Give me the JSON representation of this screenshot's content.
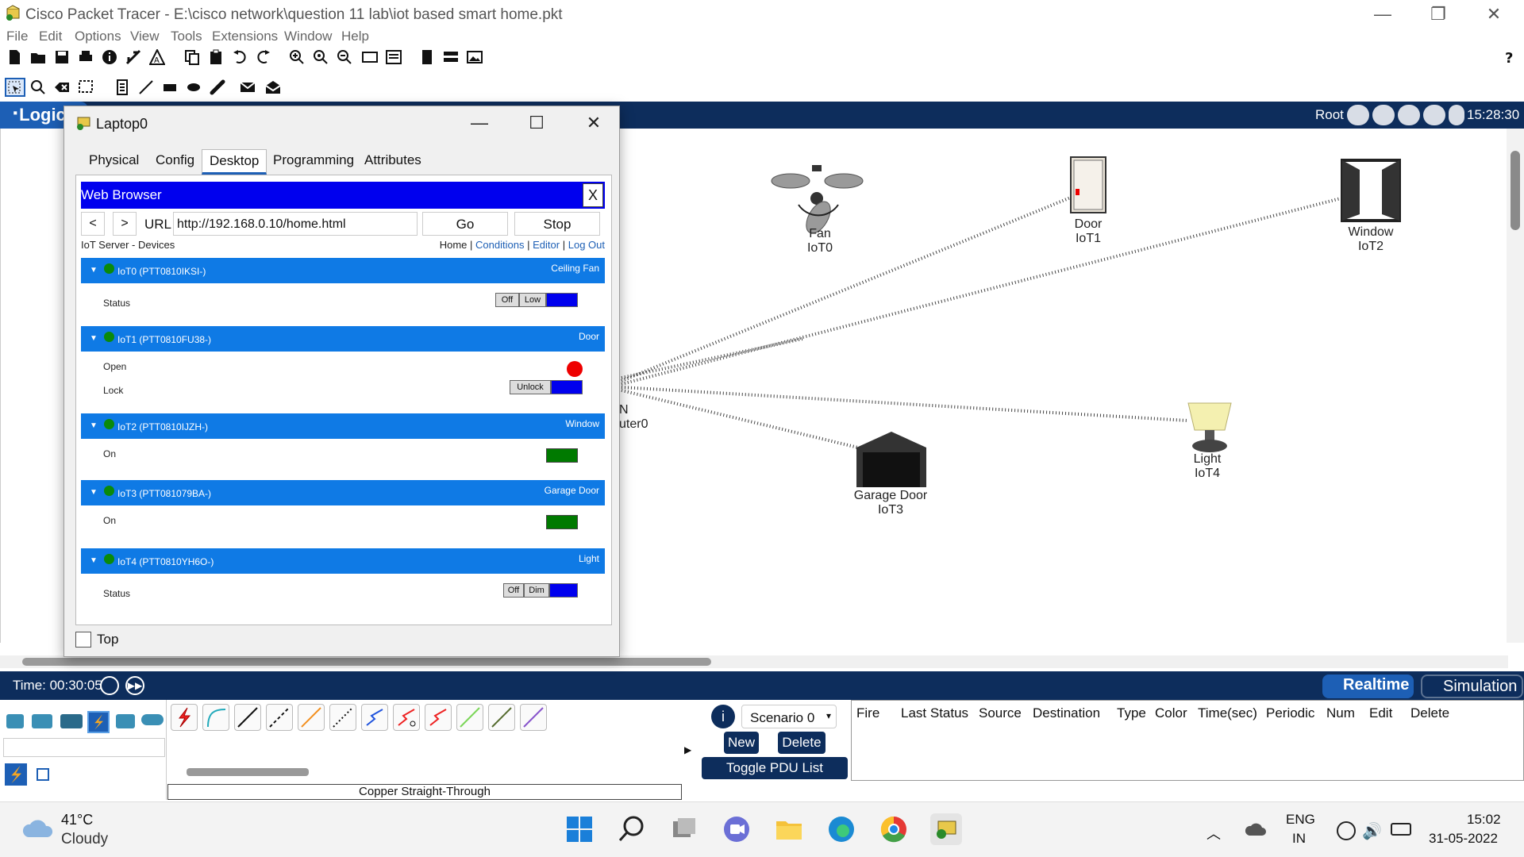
{
  "window": {
    "title": "Cisco Packet Tracer - E:\\cisco network\\question 11 lab\\iot based smart home.pkt",
    "minimize": "—",
    "restore": "❐",
    "close": "✕"
  },
  "menu": [
    "File",
    "Edit",
    "Options",
    "View",
    "Tools",
    "Extensions",
    "Window",
    "Help"
  ],
  "help_icon": "?",
  "workspace": {
    "mode_label": "Logical",
    "root_label": "Root",
    "clock": "15:28:30"
  },
  "devices": [
    {
      "name": "Fan",
      "id": "IoT0"
    },
    {
      "name": "Door",
      "id": "IoT1"
    },
    {
      "name": "Window",
      "id": "IoT2"
    },
    {
      "name": "Garage Door",
      "id": "IoT3"
    },
    {
      "name": "Light",
      "id": "IoT4"
    }
  ],
  "router_partial": [
    "N",
    "uter0"
  ],
  "timebar": {
    "time": "Time: 00:30:05",
    "realtime": "Realtime",
    "simulation": "Simulation"
  },
  "bottom": {
    "cable_caption": "Copper Straight-Through",
    "scenario": "Scenario 0",
    "new": "New",
    "delete": "Delete",
    "toggle": "Toggle PDU List Window",
    "pdu_headers": [
      "Fire",
      "Last Status",
      "Source",
      "Destination",
      "Type",
      "Color",
      "Time(sec)",
      "Periodic",
      "Num",
      "Edit",
      "Delete"
    ]
  },
  "dialog": {
    "title": "Laptop0",
    "minimize": "—",
    "maximize": "☐",
    "close": "✕",
    "tabs": [
      "Physical",
      "Config",
      "Desktop",
      "Programming",
      "Attributes"
    ],
    "active_tab": "Desktop",
    "top_label": "Top",
    "browser": {
      "title": "Web Browser",
      "close": "X",
      "back": "<",
      "forward": ">",
      "url_label": "URL",
      "url": "http://192.168.0.10/home.html",
      "go": "Go",
      "stop": "Stop",
      "page_title": "IoT Server - Devices",
      "link_home": "Home",
      "link_conditions": "Conditions",
      "link_editor": "Editor",
      "link_logout": "Log Out",
      "separator": "|"
    },
    "iot": [
      {
        "name": "IoT0 (PTT0810IKSI-)",
        "type": "Ceiling Fan",
        "rows": [
          {
            "label": "Status",
            "buttons": [
              "Off",
              "Low"
            ]
          }
        ]
      },
      {
        "name": "IoT1 (PTT0810FU38-)",
        "type": "Door",
        "rows": [
          {
            "label": "Open"
          },
          {
            "label": "Lock",
            "buttons": [
              "Unlock"
            ]
          }
        ]
      },
      {
        "name": "IoT2 (PTT0810IJZH-)",
        "type": "Window",
        "rows": [
          {
            "label": "On"
          }
        ]
      },
      {
        "name": "IoT3 (PTT081079BA-)",
        "type": "Garage Door",
        "rows": [
          {
            "label": "On"
          }
        ]
      },
      {
        "name": "IoT4 (PTT0810YH6O-)",
        "type": "Light",
        "rows": [
          {
            "label": "Status",
            "buttons": [
              "Off",
              "Dim"
            ]
          }
        ]
      }
    ]
  },
  "taskbar": {
    "temp": "41°C",
    "weather": "Cloudy",
    "lang": "ENG",
    "region": "IN",
    "time": "15:02",
    "date": "31-05-2022"
  },
  "colors": {
    "accent": "#1d5fb5",
    "workspace_bar": "#0d2d5c",
    "browser_bar": "#0000ee",
    "iot_header": "#0f7ae5",
    "status_green": "#007a00",
    "alert_red": "#ee0000"
  }
}
